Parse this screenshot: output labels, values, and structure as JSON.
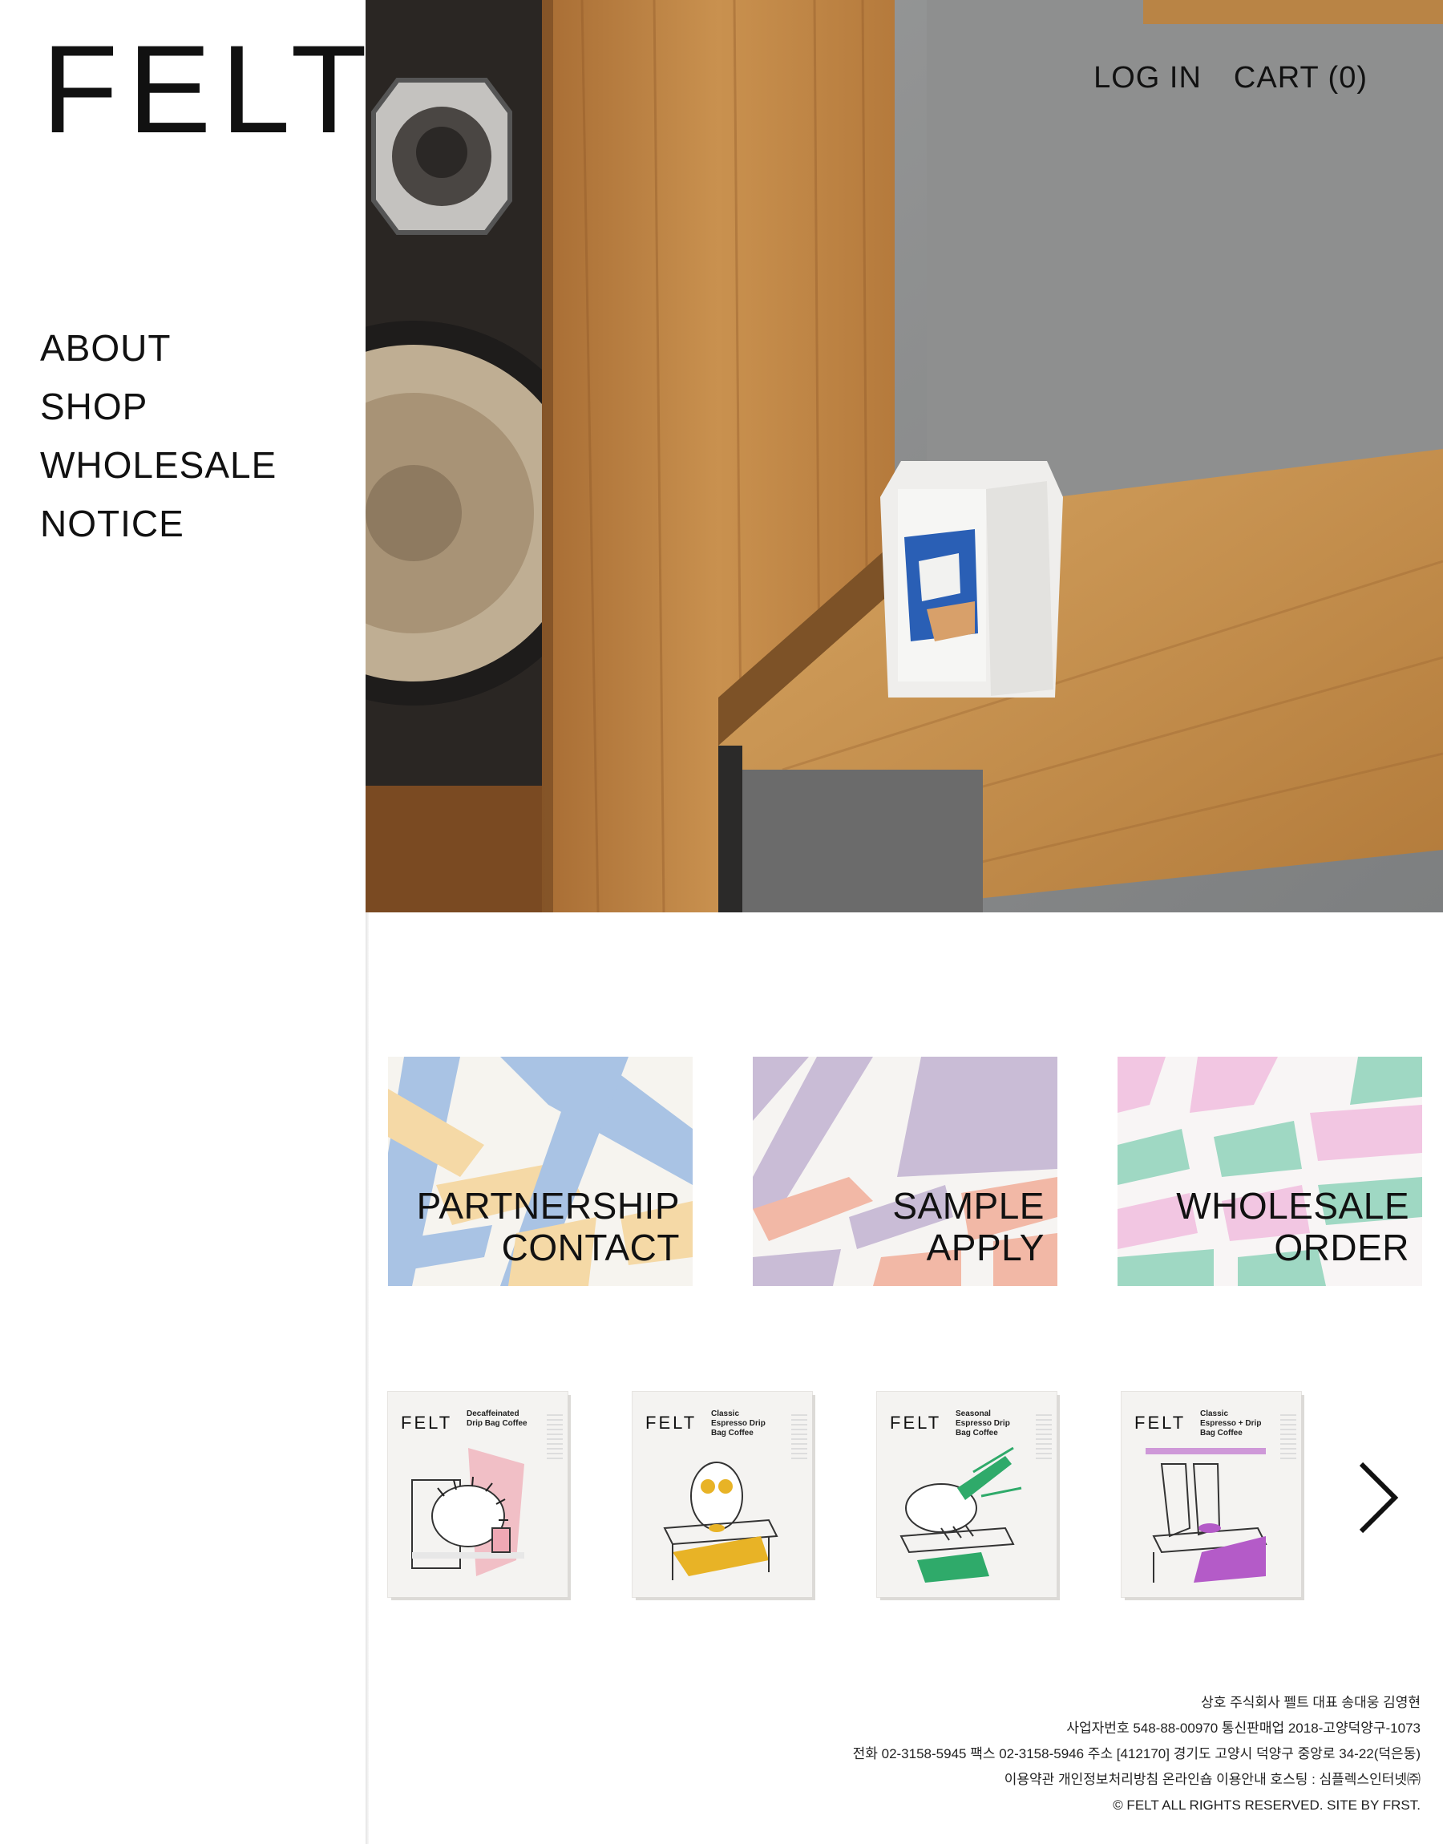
{
  "brand": {
    "logo_text": "FELT"
  },
  "sidebar": {
    "nav": [
      {
        "label": "ABOUT"
      },
      {
        "label": "SHOP"
      },
      {
        "label": "WHOLESALE"
      },
      {
        "label": "NOTICE"
      }
    ]
  },
  "header": {
    "login_label": "LOG IN",
    "cart_label": "CART (0)"
  },
  "cards": [
    {
      "line1": "PARTNERSHIP",
      "line2": "CONTACT",
      "palette": [
        "#a9c3e4",
        "#f5d9a6"
      ]
    },
    {
      "line1": "SAMPLE",
      "line2": "APPLY",
      "palette": [
        "#c9bcd6",
        "#f2b8a6"
      ]
    },
    {
      "line1": "WHOLESALE",
      "line2": "ORDER",
      "palette": [
        "#9fd8c3",
        "#f2c6e2"
      ]
    }
  ],
  "products": [
    {
      "logo": "FELT",
      "name": "Decaffeinated Drip Bag Coffee",
      "accent": "#f0a8b4"
    },
    {
      "logo": "FELT",
      "name": "Classic Espresso Drip Bag Coffee",
      "accent": "#e8b326"
    },
    {
      "logo": "FELT",
      "name": "Seasonal Espresso Drip Bag Coffee",
      "accent": "#2faa6a"
    },
    {
      "logo": "FELT",
      "name": "Classic Espresso + Drip Bag Coffee",
      "accent": "#b45bc8"
    }
  ],
  "carousel": {
    "next_icon": "chevron-right-icon"
  },
  "footer": {
    "lines": [
      "상호 주식회사 펠트 대표 송대웅 김영현",
      "사업자번호 548-88-00970 통신판매업 2018-고양덕양구-1073",
      "전화 02-3158-5945 팩스 02-3158-5946 주소 [412170] 경기도 고양시 덕양구 중앙로 34-22(덕은동)",
      "이용약관 개인정보처리방침 온라인숍 이용안내 호스팅 : 심플렉스인터넷㈜",
      "© FELT ALL RIGHTS RESERVED. SITE BY FRST."
    ]
  }
}
